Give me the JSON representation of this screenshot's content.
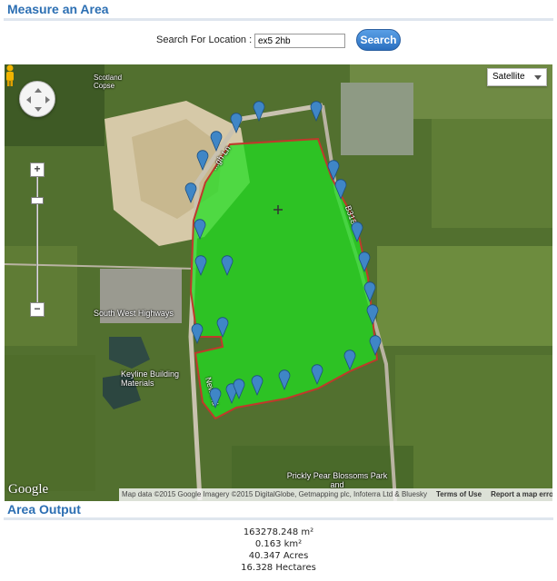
{
  "header": {
    "title": "Measure an Area"
  },
  "search": {
    "label": "Search For Location :",
    "value": "ex5 2hb",
    "button_label": "Search"
  },
  "map": {
    "map_type": "Satellite",
    "zoom_in": "+",
    "zoom_out": "−",
    "labels": {
      "scotland_copse": "Scotland\nCopse",
      "south_west_highways": "South West Highways",
      "keyline": "Keyline Building\nMaterials",
      "new_rd": "New Rd",
      "b3181": "B3181",
      "prickly_pear": "Prickly Pear\nBlossoms Park and",
      "lane": "...gh Ln"
    },
    "attribution": "Map data ©2015 Google Imagery ©2015 DigitalGlobe, Getmapping plc, Infoterra Ltd & Bluesky",
    "terms": "Terms of Use",
    "report": "Report a map error",
    "logo": "Google",
    "polygon_fill_color": "#22dd22",
    "polygon_edge_color": "#c0392b",
    "marker_color": "#3f86c6"
  },
  "output": {
    "title": "Area Output",
    "square_meters": "163278.248 m²",
    "square_km": "0.163 km²",
    "acres": "40.347 Acres",
    "hectares": "16.328 Hectares"
  }
}
